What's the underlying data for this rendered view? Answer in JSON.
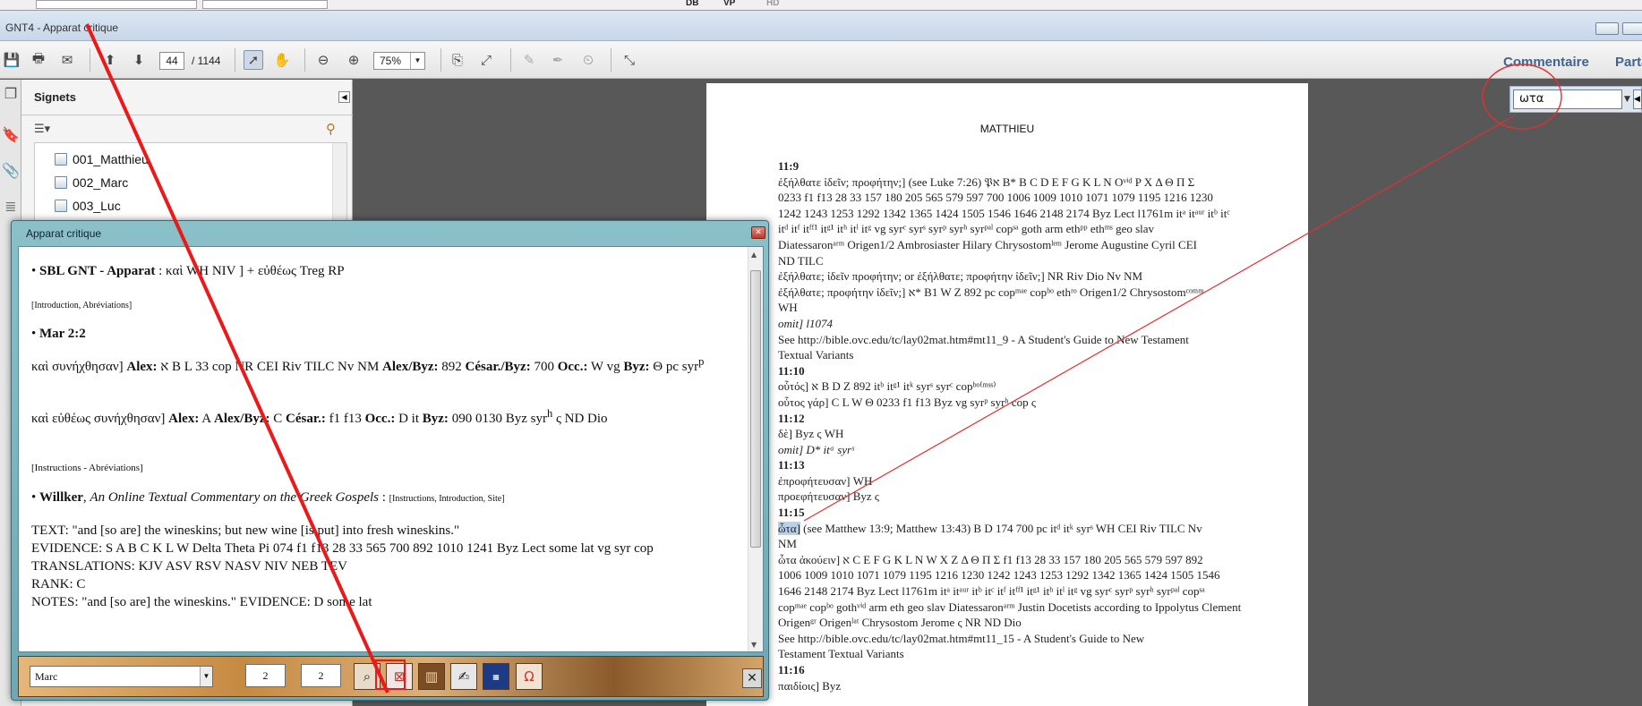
{
  "window": {
    "title": "GNT4 - Apparat critique"
  },
  "topstrip": {
    "labels": [
      "DB",
      "VP",
      "HD"
    ]
  },
  "toolbar": {
    "current_page": "44",
    "total_pages": "/ 1144",
    "zoom": "75%",
    "commentaire": "Commentaire",
    "partager": "Parta"
  },
  "bookmarks": {
    "title": "Signets",
    "items": [
      "001_Matthieu",
      "002_Marc",
      "003_Luc"
    ]
  },
  "search": {
    "value": "ωτα"
  },
  "document": {
    "page_title": "MATTHIEU"
  },
  "popup": {
    "title": "Apparat critique",
    "book": "Marc",
    "chapter": "2",
    "verse": "2",
    "sbl_line": {
      "label": "SBL GNT - Apparat",
      "rest": " : καὶ WH NIV ] + εὐθέως Treg RP"
    },
    "intro_abbr": "[Introduction, Abréviations]",
    "verse_ref": "Mar 2:2",
    "var1": {
      "lemma": "καὶ συνήχθησαν] ",
      "alex_label": "Alex:",
      "alex": " א B L 33 cop NR CEI Riv TILC Nv NM ",
      "alexbyz_label": "Alex/Byz:",
      "alexbyz": " 892 ",
      "cesbyz_label": "César./Byz:",
      "cesbyz": " 700 ",
      "occ_label": "Occ.:",
      "occ": " W vg ",
      "byz_label": "Byz:",
      "byz": " Θ pc syr",
      "sup": "p"
    },
    "var2": {
      "lemma": "καὶ εὐθέως συνήχθησαν] ",
      "alex_label": "Alex:",
      "alex": " A ",
      "alexbyz_label": "Alex/Byz:",
      "alexbyz": " C ",
      "ces_label": "César.:",
      "ces": " f1 f13 ",
      "occ_label": "Occ.:",
      "occ": " D it ",
      "byz_label": "Byz:",
      "byz": " 090 0130 Byz syr",
      "sup": "h",
      "tail": " ς ND Dio"
    },
    "instr_abbr": "[Instructions - Abréviations]",
    "willker": {
      "name": "Willker",
      "title": "An Online Textual Commentary on the Greek Gospels",
      "links": "[Instructions, Introduction, Site]"
    },
    "text_lines": [
      "TEXT: \"and [so are] the wineskins; but new wine [is put] into fresh wineskins.\"",
      "EVIDENCE: S A B C K L W Delta Theta Pi 074 f1 f13 28 33 565 700 892 1010 1241 Byz Lect some lat vg syr cop",
      "TRANSLATIONS: KJV ASV RSV NASV NIV NEB TEV",
      "RANK: C",
      "NOTES: \"and [so are] the wineskins.\" EVIDENCE: D some lat"
    ]
  },
  "doc_lines": [
    {
      "t": "11:9",
      "b": true
    },
    {
      "t": "ἐξήλθατε ἰδεῖν; προφήτην;] (see Luke 7:26) 𝔓א B* B C D E F G K L N Oᵛⁱᵈ P X Δ Θ Π Σ"
    },
    {
      "t": "0233 f1 f13 28 33 157 180 205 565 579 597 700 1006 1009 1010 1071 1079 1195 1216 1230"
    },
    {
      "t": "1242 1243 1253 1292 1342 1365 1424 1505 1546 1646 2148 2174 Byz Lect l1761m itᵃ itᵃᵘʳ itᵇ itᶜ"
    },
    {
      "t": "itᵈ itᶠ itᶠᶠ¹ itᵍ¹ itʰ itˡ itᵍ vg syrᶜ syrˢ syrᵖ syrʰ syrᵖᵃˡ copˢᵃ goth arm ethᵖᵖ ethᵐˢ geo slav"
    },
    {
      "t": "Diatessaronᵃʳᵐ Origen1/2 Ambrosiaster Hilary Chrysostomˡᵉᵐ Jerome Augustine Cyril CEI"
    },
    {
      "t": "ND TILC"
    },
    {
      "t": "ἐξήλθατε; ἰδεῖν προφήτην; or ἐξήλθατε; προφήτην ἰδεῖν;] NR Riv Dio Nv NM"
    },
    {
      "t": "ἐξήλθατε; προφήτην ἰδεῖν;] א* B1 W Z 892 pc copᵐᵃᵉ copᵇᵒ ethʳᵒ Origen1/2 Chrysostomᶜᵒᵐᵐ"
    },
    {
      "t": "WH"
    },
    {
      "t": "omit] l1074",
      "i": true
    },
    {
      "t": "See http://bible.ovc.edu/tc/lay02mat.htm#mt11_9 - A Student's Guide to New Testament"
    },
    {
      "t": "Textual Variants"
    },
    {
      "t": "11:10",
      "b": true
    },
    {
      "t": "οὗτός] א B D Z 892 itᵇ itᵍ¹ itᵏ syrˢ syrᶜ copᵇᵒ⁽ᵐˢˢ⁾"
    },
    {
      "t": "οὗτος γάρ] C L W Θ 0233 f1 f13 Byz vg syrᵖ syrʰ cop ς"
    },
    {
      "t": "11:12",
      "b": true
    },
    {
      "t": "δὲ] Byz ς WH"
    },
    {
      "t": "omit] D* itᵃ syrˢ",
      "i": true
    },
    {
      "t": "11:13",
      "b": true
    },
    {
      "t": "ἐπροφήτευσαν] WH"
    },
    {
      "t": "προεφήτευσαν] Byz ς"
    },
    {
      "t": "11:15",
      "b": true
    },
    {
      "t": "ὦτα] (see Matthew 13:9; Matthew 13:43) B D 174 700 pc itᵈ itᵏ syrˢ WH CEI Riv TILC Nv",
      "hl": true
    },
    {
      "t": "NM"
    },
    {
      "t": "ὦτα ἀκούειν] א C E F G K L N W X Z Δ Θ Π Σ f1 f13 28 33 157 180 205 565 579 597 892"
    },
    {
      "t": "1006 1009 1010 1071 1079 1195 1216 1230 1242 1243 1253 1292 1342 1365 1424 1505 1546"
    },
    {
      "t": "1646 2148 2174 Byz Lect l1761m itᵃ itᵃᵘʳ itᵇ itᶜ itᶠ itᶠᶠ¹ itᵍ¹ itʰ itˡ itᵍ vg syrᶜ syrᵖ syrʰ syrᵖᵃˡ copˢᵃ"
    },
    {
      "t": "copᵐᵃᵉ copᵇᵒ gothᵛⁱᵈ arm eth geo slav Diatessaronᵃʳᵐ Justin Docetists according to Ippolytus Clement"
    },
    {
      "t": "Origenᵍʳ Origenˡᵃᵗ Chrysostom Jerome ς NR ND Dio"
    },
    {
      "t": "See http://bible.ovc.edu/tc/lay02mat.htm#mt11_15 - A Student's Guide to New"
    },
    {
      "t": "Testament Textual Variants"
    },
    {
      "t": "11:16",
      "b": true
    },
    {
      "t": "παιδίοις] Byz"
    }
  ]
}
